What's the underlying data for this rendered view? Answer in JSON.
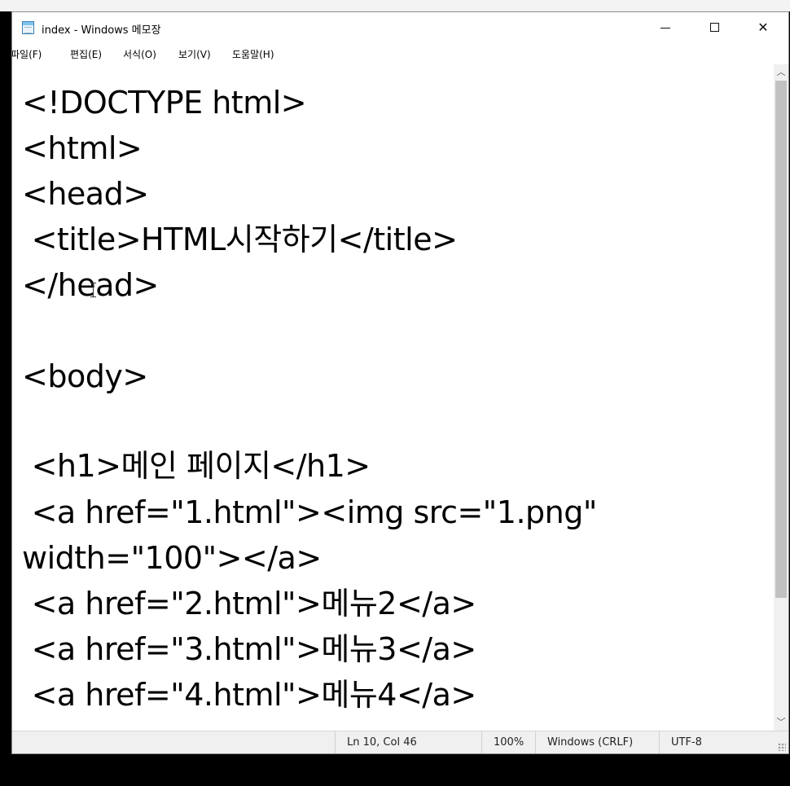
{
  "window": {
    "title": "index - Windows 메모장",
    "controls": {
      "minimize_icon": "minimize-icon",
      "maximize_icon": "maximize-icon",
      "close_icon": "close-icon"
    }
  },
  "menu": {
    "items": [
      "파일(F)",
      "편집(E)",
      "서식(O)",
      "보기(V)",
      "도움말(H)"
    ]
  },
  "editor": {
    "lines": [
      "<!DOCTYPE html>",
      "<html>",
      "<head>",
      " <title>HTML시작하기</title>",
      "</head>",
      "",
      "<body>",
      "",
      " <h1>메인 페이지</h1>",
      " <a href=\"1.html\"><img src=\"1.png\"",
      "width=\"100\"></a>",
      " <a href=\"2.html\">메뉴2</a>",
      " <a href=\"3.html\">메뉴3</a>",
      " <a href=\"4.html\">메뉴4</a>"
    ]
  },
  "status": {
    "position": "Ln 10, Col 46",
    "zoom": "100%",
    "line_ending": "Windows (CRLF)",
    "encoding": "UTF-8"
  },
  "colors": {
    "accent": "#0078d7",
    "status_bg": "#f0f0f0",
    "scroll_thumb": "#c1c1c1"
  }
}
